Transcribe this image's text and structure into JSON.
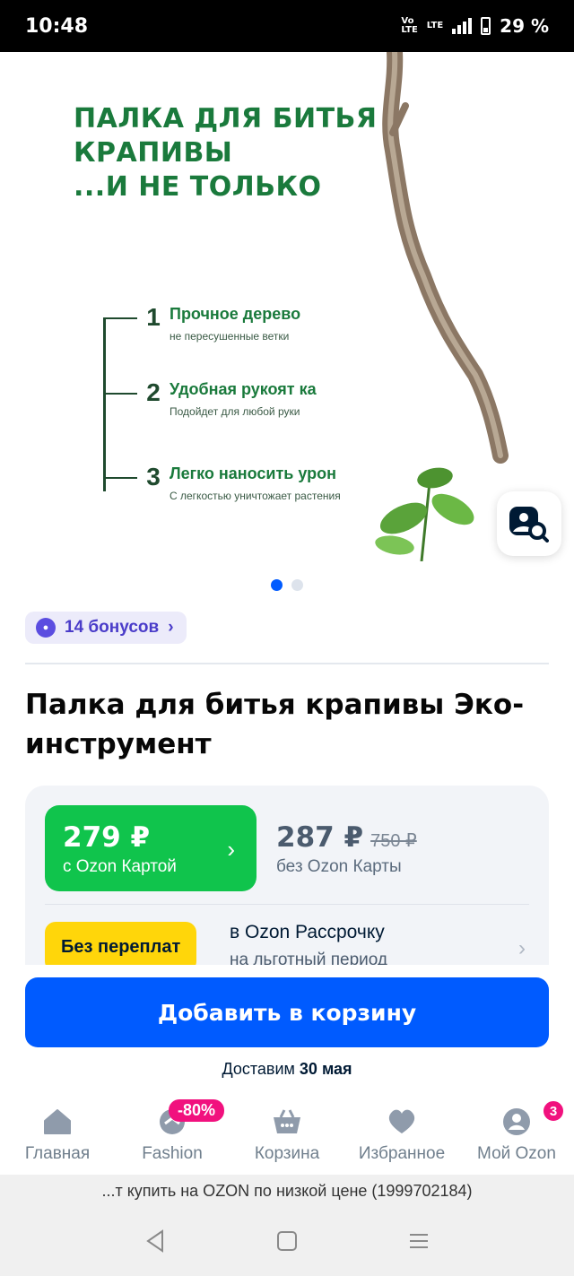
{
  "status_bar": {
    "time": "10:48",
    "network": "LTE",
    "battery": "29 %"
  },
  "hero": {
    "headline_lines": [
      "ПАЛКА ДЛЯ БИТЬЯ",
      "КРАПИВЫ",
      "...И НЕ ТОЛЬКО"
    ],
    "features": [
      {
        "num": "1",
        "title": "Прочное дерево",
        "sub": "не пересушенные ветки"
      },
      {
        "num": "2",
        "title": "Удобная рукоят ка",
        "sub": "Подойдет для любой руки"
      },
      {
        "num": "3",
        "title": "Легко наносить урон",
        "sub": "С легкостью уничтожает растения"
      }
    ],
    "slides_total": 2,
    "slide_active": 1
  },
  "bonus": {
    "label": "14 бонусов"
  },
  "product": {
    "title": "Палка для битья крапивы Эко-инструмент"
  },
  "prices": {
    "ozon_card_price": "279 ₽",
    "ozon_card_label": "с Ozon Картой",
    "regular_price": "287 ₽",
    "old_price": "750 ₽",
    "regular_label": "без Ozon Карты",
    "installment_badge": "Без переплат",
    "installment_title": "в Ozon Рассрочку",
    "installment_sub": "на льготный период"
  },
  "actions": {
    "add_to_cart": "Добавить в корзину"
  },
  "delivery": {
    "prefix": "Доставим",
    "date": "30 мая"
  },
  "tabbar": {
    "items": [
      {
        "label": "Главная",
        "icon": "home-icon"
      },
      {
        "label": "Fashion",
        "icon": "fashion-icon",
        "promo": "-80%"
      },
      {
        "label": "Корзина",
        "icon": "cart-icon"
      },
      {
        "label": "Избранное",
        "icon": "heart-icon"
      },
      {
        "label": "Мой Ozon",
        "icon": "profile-icon",
        "count": "3"
      }
    ]
  },
  "browser": {
    "url_text": "...т купить на OZON по низкой цене (1999702184)"
  },
  "colors": {
    "accent": "#005bff",
    "ozon_card": "#10c44c",
    "promo": "#f1117e",
    "badge": "#ffd60a"
  }
}
